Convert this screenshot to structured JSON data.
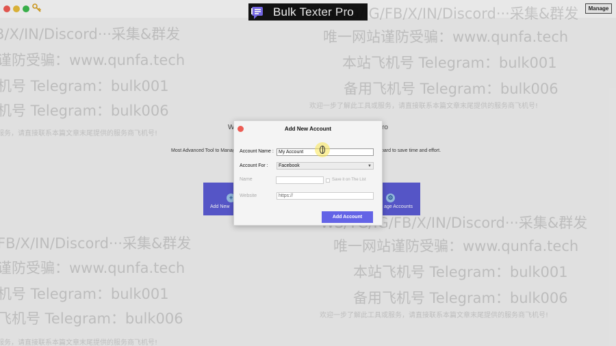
{
  "app": {
    "brand_name": "Bulk Texter Pro",
    "manage_label": "Manage"
  },
  "main": {
    "heading_start": "W",
    "heading_end": "ro",
    "subtitle_left": "Most Advanced Tool to Manag",
    "subtitle_right": "oard to save time and effort.",
    "cards": [
      {
        "label": "Add New"
      },
      {
        "label": "age Accounts"
      }
    ]
  },
  "watermark": {
    "line_platforms": "WS/TG/IG/FB/X/IN/Discord···采集&群发",
    "line_platforms_cut": "B/X/IN/Discord···采集&群发",
    "line_platforms_cut2": "FB/X/IN/Discord···采集&群发",
    "line_site": "唯一网站谨防受骗：www.qunfa.tech",
    "line_site_cut": "谨防受骗：www.qunfa.tech",
    "line_tg1": "本站飞机号 Telegram：bulk001",
    "line_tg1_cut": "机号 Telegram：bulk001",
    "line_tg1_cut2": "飞机号 Telegram：bulk001",
    "line_tg2": "备用飞机号 Telegram：bulk006",
    "line_tg2_cut": "机号 Telegram：bulk006",
    "line_tg2_cut2": "飞机号 Telegram：bulk006",
    "line_small": "欢迎一步了解此工具或服务，请直接联系本篇文章末尾提供的服务商飞机号!",
    "line_small_cut": "服务，请直接联系本篇文章末尾提供的服务商飞机号!",
    "line_small_cut2": "服务，请直接联系本篇文章末尾提供的服务商飞机号!"
  },
  "dialog": {
    "title": "Add New Account",
    "account_name_label": "Account Name :",
    "account_name_value": "My Account",
    "account_for_label": "Account For :",
    "account_for_value": "Facebook",
    "name_label": "Name",
    "name_value": "",
    "save_checkbox_label": "Save it on The List",
    "website_label": "Website",
    "website_value": "https://",
    "add_button_label": "Add Account"
  },
  "colors": {
    "accent": "#6363e6",
    "card": "#5b5bd3",
    "close": "#ec5c54"
  }
}
